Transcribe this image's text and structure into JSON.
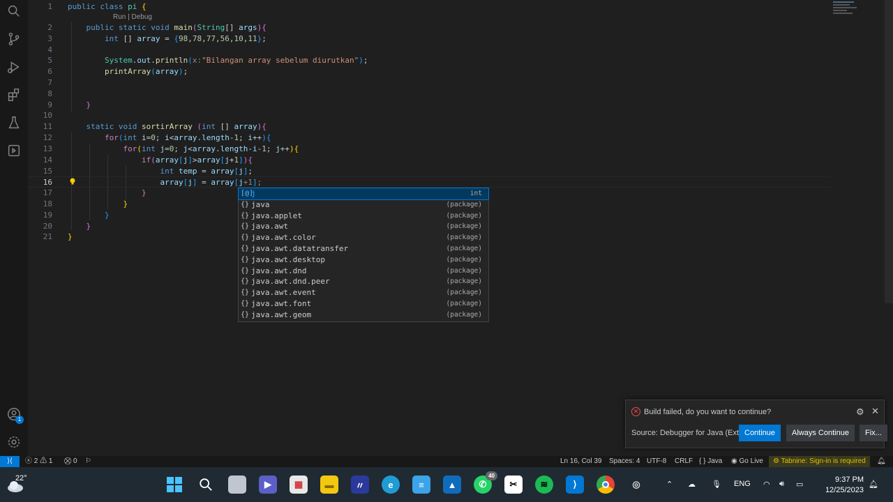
{
  "editor": {
    "codelens": "Run | Debug",
    "lines": [
      {
        "n": "1",
        "code": "public class pi {"
      },
      {
        "n": "2",
        "code": "    public static void main(String[] args){"
      },
      {
        "n": "3",
        "code": "        int [] array = {98,78,77,56,10,11};"
      },
      {
        "n": "4",
        "code": ""
      },
      {
        "n": "5",
        "code": "        System.out.println(x:\"Bilangan array sebelum diurutkan\");"
      },
      {
        "n": "6",
        "code": "        printArray(array);"
      },
      {
        "n": "7",
        "code": ""
      },
      {
        "n": "8",
        "code": ""
      },
      {
        "n": "9",
        "code": "    }"
      },
      {
        "n": "10",
        "code": ""
      },
      {
        "n": "11",
        "code": "    static void sortirArray (int [] array){"
      },
      {
        "n": "12",
        "code": "        for(int i=0; i<array.length-1; i++){"
      },
      {
        "n": "13",
        "code": "            for(int j=0; j<array.length-i-1; j++){"
      },
      {
        "n": "14",
        "code": "                if(array[j]>array[j+1]){"
      },
      {
        "n": "15",
        "code": "                    int temp = array[j];"
      },
      {
        "n": "16",
        "code": "                    array[j] = array[j+1];"
      },
      {
        "n": "17",
        "code": "                }"
      },
      {
        "n": "18",
        "code": "            }"
      },
      {
        "n": "19",
        "code": "        }"
      },
      {
        "n": "20",
        "code": "    }"
      },
      {
        "n": "21",
        "code": "}"
      }
    ]
  },
  "suggest": {
    "items": [
      {
        "icon": "[@]",
        "label": "j",
        "detail": "int",
        "selected": true
      },
      {
        "icon": "{}",
        "label": "java",
        "detail": "(package)"
      },
      {
        "icon": "{}",
        "label": "java.applet",
        "detail": "(package)"
      },
      {
        "icon": "{}",
        "label": "java.awt",
        "detail": "(package)"
      },
      {
        "icon": "{}",
        "label": "java.awt.color",
        "detail": "(package)"
      },
      {
        "icon": "{}",
        "label": "java.awt.datatransfer",
        "detail": "(package)"
      },
      {
        "icon": "{}",
        "label": "java.awt.desktop",
        "detail": "(package)"
      },
      {
        "icon": "{}",
        "label": "java.awt.dnd",
        "detail": "(package)"
      },
      {
        "icon": "{}",
        "label": "java.awt.dnd.peer",
        "detail": "(package)"
      },
      {
        "icon": "{}",
        "label": "java.awt.event",
        "detail": "(package)"
      },
      {
        "icon": "{}",
        "label": "java.awt.font",
        "detail": "(package)"
      },
      {
        "icon": "{}",
        "label": "java.awt.geom",
        "detail": "(package)"
      }
    ]
  },
  "notification": {
    "message": "Build failed, do you want to continue?",
    "source": "Source: Debugger for Java (Exte...",
    "continue": "Continue",
    "always_continue": "Always Continue",
    "fix": "Fix..."
  },
  "statusbar": {
    "errors": "2",
    "warnings": "1",
    "ports": "0",
    "position": "Ln 16, Col 39",
    "spaces": "Spaces: 4",
    "encoding": "UTF-8",
    "eol": "CRLF",
    "language": "Java",
    "golive": "Go Live",
    "tabnine": "Tabnine: Sign-in is required"
  },
  "activity_badge": "1",
  "taskbar": {
    "temperature": "22°",
    "whatsapp_badge": "40",
    "language": "ENG",
    "time": "9:37 PM",
    "date": "12/25/2023"
  },
  "colors": {
    "accent": "#0078d4",
    "error": "#f14c4c",
    "editor_bg": "#1f1f1f"
  }
}
